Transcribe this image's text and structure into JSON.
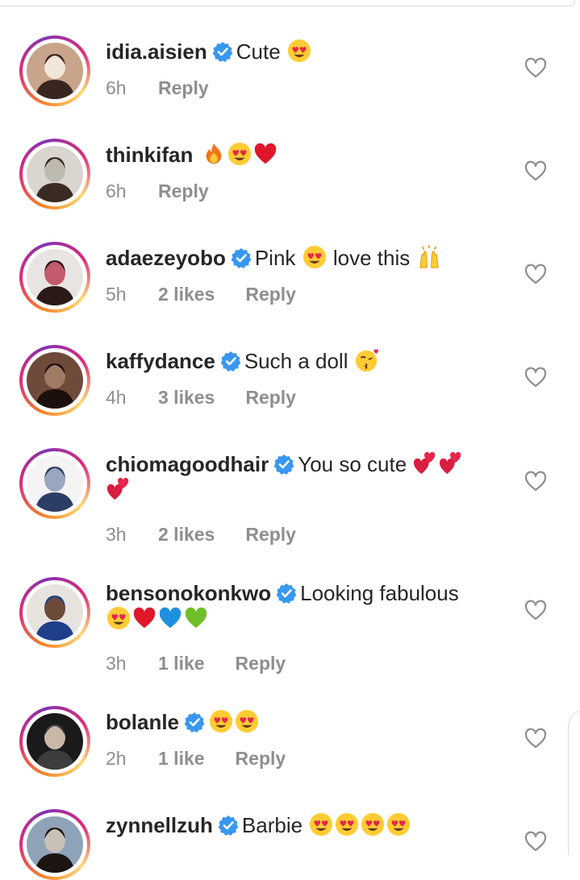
{
  "comments": [
    {
      "username": "idia.aisien",
      "verified": true,
      "text": "Cute",
      "emojis": [
        "heart-eyes"
      ],
      "wrap_emojis": [],
      "time": "6h",
      "likes": "",
      "reply": "Reply",
      "avatar_palette": [
        "#c8a58a",
        "#3a2620",
        "#f2e6d8"
      ]
    },
    {
      "username": "thinkifan",
      "verified": false,
      "text": "",
      "emojis": [
        "fire",
        "heart-eyes",
        "red-heart"
      ],
      "wrap_emojis": [],
      "time": "6h",
      "likes": "",
      "reply": "Reply",
      "avatar_palette": [
        "#d9d6cf",
        "#3b2a22",
        "#bfbab0"
      ]
    },
    {
      "username": "adaezeyobo",
      "verified": true,
      "text": "Pink",
      "emojis": [
        "heart-eyes"
      ],
      "text_after": "love this",
      "emojis_after": [
        "raising-hands"
      ],
      "wrap_emojis": [],
      "time": "5h",
      "likes": "2 likes",
      "reply": "Reply",
      "avatar_palette": [
        "#e8e4e2",
        "#2a1a17",
        "#c25b6b"
      ]
    },
    {
      "username": "kaffydance",
      "verified": true,
      "text": "Such a doll",
      "emojis": [
        "kissing-face"
      ],
      "wrap_emojis": [],
      "time": "4h",
      "likes": "3 likes",
      "reply": "Reply",
      "avatar_palette": [
        "#6e4a3a",
        "#1c100c",
        "#a07a62"
      ]
    },
    {
      "username": "chiomagoodhair",
      "verified": true,
      "text": "You so cute",
      "emojis": [
        "two-hearts",
        "two-hearts"
      ],
      "wrap_emojis": [
        "two-hearts"
      ],
      "time": "3h",
      "likes": "2 likes",
      "reply": "Reply",
      "avatar_palette": [
        "#f4f4f4",
        "#2c3e66",
        "#9aa6bd"
      ]
    },
    {
      "username": "bensonokonkwo",
      "verified": true,
      "text": "Looking fabulous",
      "emojis": [],
      "wrap_emojis": [
        "heart-eyes",
        "red-heart",
        "blue-heart",
        "green-heart"
      ],
      "time": "3h",
      "likes": "1 like",
      "reply": "Reply",
      "avatar_palette": [
        "#e7e3df",
        "#1e3f8a",
        "#6b4a3a"
      ]
    },
    {
      "username": "bolanle",
      "verified": true,
      "text": "",
      "emojis": [
        "heart-eyes",
        "heart-eyes"
      ],
      "wrap_emojis": [],
      "time": "2h",
      "likes": "1 like",
      "reply": "Reply",
      "avatar_palette": [
        "#1a1a1a",
        "#3d3d3d",
        "#c9b7a8"
      ]
    },
    {
      "username": "zynnellzuh",
      "verified": true,
      "text": "Barbie",
      "emojis": [
        "heart-eyes",
        "heart-eyes",
        "heart-eyes",
        "heart-eyes"
      ],
      "wrap_emojis": [],
      "time": "",
      "likes": "",
      "reply": "",
      "avatar_palette": [
        "#8fa3b8",
        "#1b1410",
        "#c9c1b7"
      ]
    }
  ],
  "colors": {
    "text": "#262626",
    "meta": "#8e8e8e",
    "verified_blue": "#3897f0",
    "heart_outline": "#8e8e8e"
  },
  "icons": {
    "like": "heart-outline-icon",
    "verified": "verified-badge-icon"
  }
}
